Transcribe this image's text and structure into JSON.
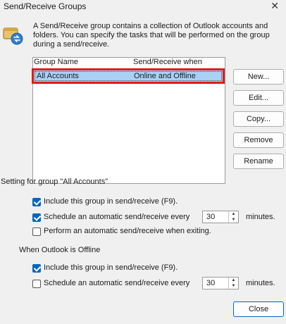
{
  "window": {
    "title": "Send/Receive Groups",
    "close_glyph": "✕"
  },
  "description": "A Send/Receive group contains a collection of Outlook accounts and folders. You can specify the tasks that will be performed on the group during a send/receive.",
  "list": {
    "columns": [
      "Group Name",
      "Send/Receive when"
    ],
    "rows": [
      {
        "name": "All Accounts",
        "when": "Online and Offline",
        "selected": true
      }
    ]
  },
  "buttons": {
    "new": "New...",
    "edit": "Edit...",
    "copy": "Copy...",
    "remove": "Remove",
    "rename": "Rename",
    "close": "Close"
  },
  "group_settings": {
    "title": "Setting for group \"All Accounts\"",
    "include": {
      "label": "Include this group in send/receive (F9).",
      "checked": true
    },
    "schedule": {
      "label": "Schedule an automatic send/receive every",
      "checked": true,
      "minutes": "30",
      "unit": "minutes."
    },
    "on_exit": {
      "label": "Perform an automatic send/receive when exiting.",
      "checked": false
    }
  },
  "offline_settings": {
    "title": "When Outlook is Offline",
    "include": {
      "label": "Include this group in send/receive (F9).",
      "checked": true
    },
    "schedule": {
      "label": "Schedule an automatic send/receive every",
      "checked": false,
      "minutes": "30",
      "unit": "minutes."
    }
  },
  "icons": {
    "info": "send-receive-groups-icon",
    "spin_up": "▲",
    "spin_down": "▼"
  },
  "colors": {
    "selection": "#a9d1f5",
    "highlight_border": "#e01b1b",
    "checkbox_accent": "#0067c0"
  }
}
